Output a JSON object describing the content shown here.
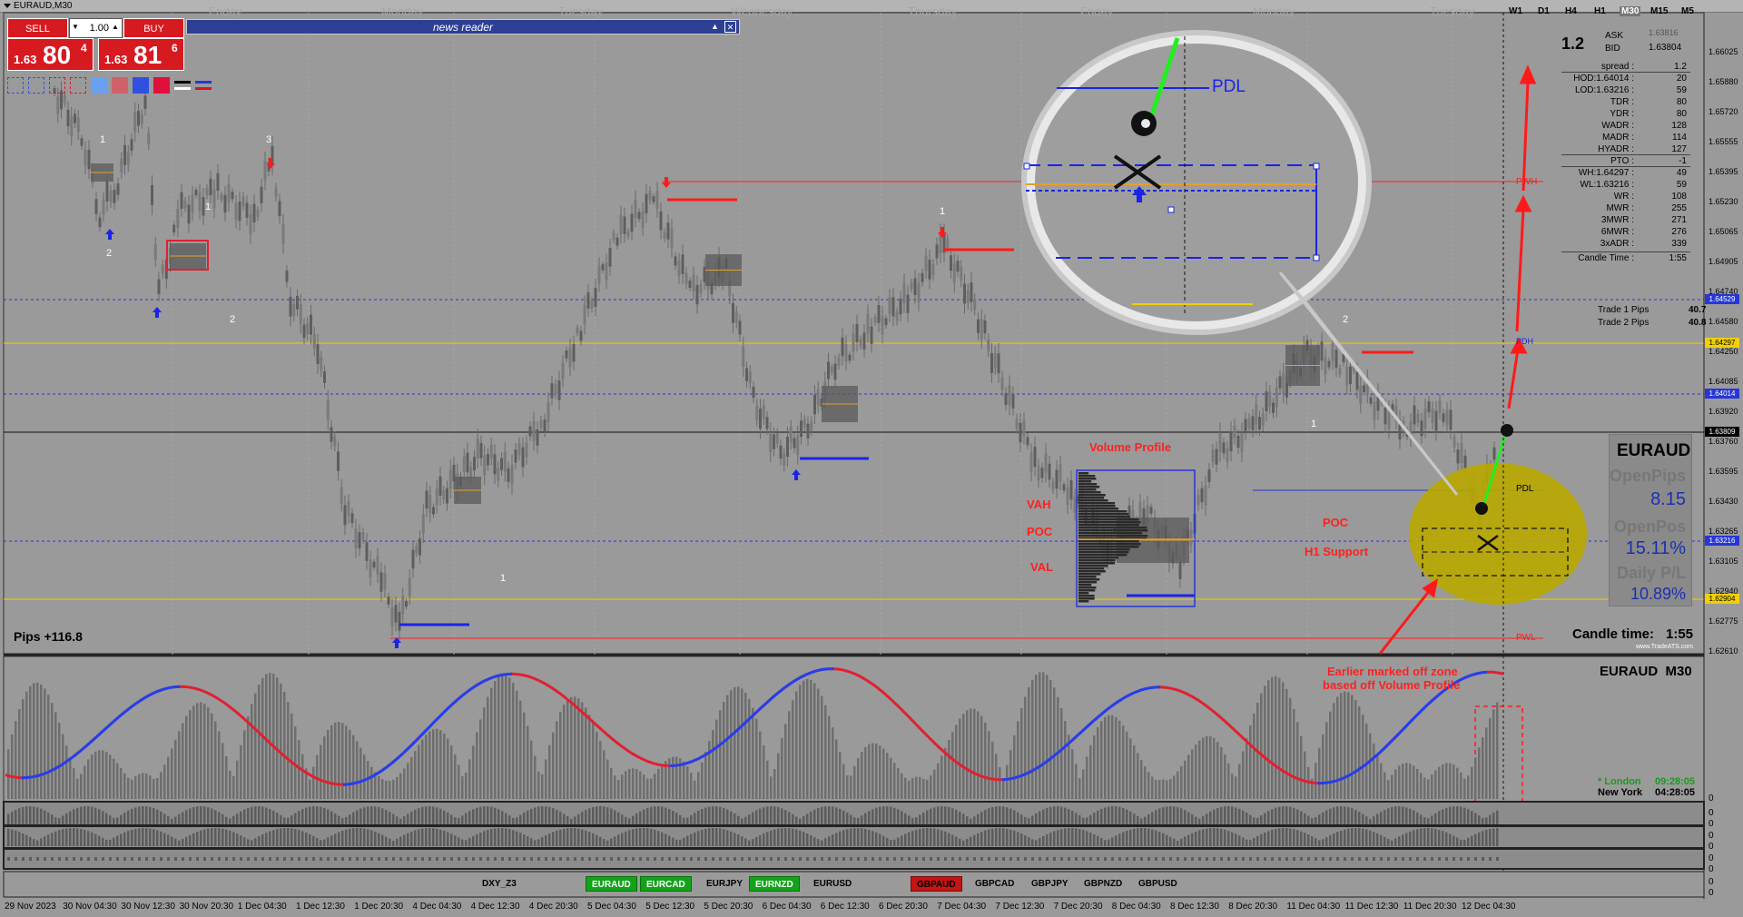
{
  "window": {
    "title": "EURAUD,M30"
  },
  "trade_panel": {
    "sell_label": "SELL",
    "buy_label": "BUY",
    "lot": "1.00",
    "sell_small": "1.63",
    "sell_big": "80",
    "sell_sup": "4",
    "buy_small": "1.63",
    "buy_big": "81",
    "buy_sup": "6"
  },
  "news_reader": {
    "title": "news reader"
  },
  "timeframes": [
    "W1",
    "D1",
    "H4",
    "H1",
    "M30",
    "M15",
    "M5"
  ],
  "active_timeframe": "M30",
  "day_labels": [
    "Friday",
    "Monday",
    "Tuesday",
    "Wednesday",
    "Thursday",
    "Friday",
    "Monday",
    "Tuesday"
  ],
  "info": {
    "spread_big": "1.2",
    "ask_label": "ASK",
    "ask_value": "1.63816",
    "bid_label": "BID",
    "bid_value": "1.63804",
    "rows": [
      {
        "k": "spread :",
        "v": "1.2"
      },
      {
        "k": "HOD:1.64014 :",
        "v": "20"
      },
      {
        "k": "LOD:1.63216 :",
        "v": "59"
      },
      {
        "k": "TDR :",
        "v": "80"
      },
      {
        "k": "YDR :",
        "v": "80"
      },
      {
        "k": "WADR :",
        "v": "128"
      },
      {
        "k": "MADR :",
        "v": "114"
      },
      {
        "k": "HYADR :",
        "v": "127"
      },
      {
        "k": "PTO :",
        "v": "-1"
      },
      {
        "k": "WH:1.64297 :",
        "v": "49"
      },
      {
        "k": "WL:1.63216 :",
        "v": "59"
      },
      {
        "k": "WR :",
        "v": "108"
      },
      {
        "k": "MWR :",
        "v": "255"
      },
      {
        "k": "3MWR :",
        "v": "271"
      },
      {
        "k": "6MWR :",
        "v": "276"
      },
      {
        "k": "3xADR :",
        "v": "339"
      },
      {
        "k": "Candle Time :",
        "v": "1:55"
      }
    ],
    "trade1_label": "Trade 1 Pips",
    "trade1_value": "40.7",
    "trade2_label": "Trade 2 Pips",
    "trade2_value": "40.8"
  },
  "open_panel": {
    "symbol": "EURAUD",
    "open_pips_label": "OpenPips",
    "open_pips_value": "8.15",
    "open_pos_label": "OpenPos",
    "open_pos_value": "15.11%",
    "daily_pl_label": "Daily P/L",
    "daily_pl_value": "10.89%",
    "candle_time_label": "Candle time:",
    "candle_time_value": "1:55",
    "brand": "www.TradeATS.com"
  },
  "pips_label": "Pips +116.8",
  "chart_labels": {
    "volume_profile": "Volume Profile",
    "vah": "VAH",
    "poc": "POC",
    "val": "VAL",
    "poc2": "POC",
    "h1_support": "H1 Support",
    "pdl": "PDL",
    "pdl_zoom": "PDL",
    "pwh": "PWH",
    "pwl": "PWL",
    "pdh": "PDH",
    "earlier_note_line1": "Earlier marked off zone",
    "earlier_note_line2": "based off Volume Profile"
  },
  "swing_numbers": [
    "1",
    "2",
    "3",
    "1",
    "2",
    "1",
    "1",
    "2",
    "1"
  ],
  "price_axis": [
    "1.66025",
    "1.65880",
    "1.65720",
    "1.65555",
    "1.65395",
    "1.65230",
    "1.65065",
    "1.64905",
    "1.64740",
    "1.64580",
    "1.64250",
    "1.64085",
    "1.63920",
    "1.63760",
    "1.63595",
    "1.63430",
    "1.63265",
    "1.63105",
    "1.62940",
    "1.62775",
    "1.62610"
  ],
  "price_tags": [
    {
      "v": "1.64529",
      "bg": "#2636d8",
      "fg": "#ffffff"
    },
    {
      "v": "1.64297",
      "bg": "#f0d000",
      "fg": "#000000"
    },
    {
      "v": "1.64014",
      "bg": "#2636d8",
      "fg": "#ffffff"
    },
    {
      "v": "1.63809",
      "bg": "#000000",
      "fg": "#ffffff"
    },
    {
      "v": "1.63216",
      "bg": "#2636d8",
      "fg": "#ffffff"
    },
    {
      "v": "1.62904",
      "bg": "#f0d000",
      "fg": "#000000"
    }
  ],
  "indicator": {
    "title": "EURAUD  M30",
    "sessions": [
      {
        "name": "* London",
        "time": "09:28:05",
        "color": "#1a9a1a"
      },
      {
        "name": "New York",
        "time": "04:28:05",
        "color": "#000000"
      }
    ],
    "zero_labels": [
      "0",
      "0",
      "0",
      "0",
      "0",
      "0",
      "0",
      "0",
      "0"
    ]
  },
  "time_axis": [
    "29 Nov 2023",
    "30 Nov 04:30",
    "30 Nov 12:30",
    "30 Nov 20:30",
    "1 Dec 04:30",
    "1 Dec 12:30",
    "1 Dec 20:30",
    "4 Dec 04:30",
    "4 Dec 12:30",
    "4 Dec 20:30",
    "5 Dec 04:30",
    "5 Dec 12:30",
    "5 Dec 20:30",
    "6 Dec 04:30",
    "6 Dec 12:30",
    "6 Dec 20:30",
    "7 Dec 04:30",
    "7 Dec 12:30",
    "7 Dec 20:30",
    "8 Dec 04:30",
    "8 Dec 12:30",
    "8 Dec 20:30",
    "11 Dec 04:30",
    "11 Dec 12:30",
    "11 Dec 20:30",
    "12 Dec 04:30"
  ],
  "symbols": [
    {
      "label": "DXY_Z3",
      "style": "plain"
    },
    {
      "label": "EURAUD",
      "style": "green"
    },
    {
      "label": "EURCAD",
      "style": "green"
    },
    {
      "label": "EURJPY",
      "style": "plain"
    },
    {
      "label": "EURNZD",
      "style": "green"
    },
    {
      "label": "EURUSD",
      "style": "plain"
    },
    {
      "label": "GBPAUD",
      "style": "red"
    },
    {
      "label": "GBPCAD",
      "style": "plain"
    },
    {
      "label": "GBPJPY",
      "style": "plain"
    },
    {
      "label": "GBPNZD",
      "style": "plain"
    },
    {
      "label": "GBPUSD",
      "style": "plain"
    }
  ],
  "colors": {
    "chart_bg": "#9a9a9a",
    "sell_red": "#d71920",
    "support_blue": "#2636d8",
    "resistance_red": "#ff1a1a",
    "yellow_line": "#f0d000",
    "zone_yellow": "#b9a800",
    "arrow_green": "#22ee22"
  }
}
